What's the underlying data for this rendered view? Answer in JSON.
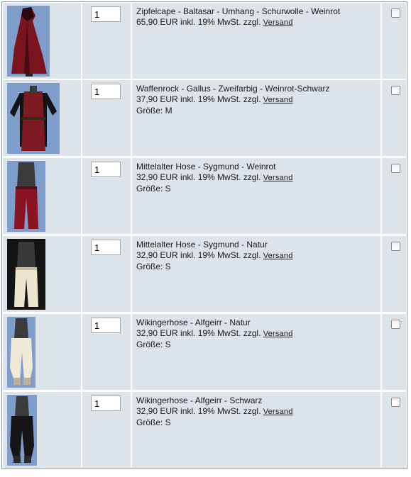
{
  "cart": {
    "items": [
      {
        "title": "Zipfelcape - Baltasar - Umhang - Schurwolle - Weinrot",
        "price": "65,90 EUR inkl. 19% MwSt. zzgl.",
        "shipping_link": "Versand",
        "size": "",
        "quantity": "1",
        "image": "red-hooded-cape-photo"
      },
      {
        "title": "Waffenrock - Gallus - Zweifarbig - Weinrot-Schwarz",
        "price": "37,90 EUR inkl. 19% MwSt. zzgl.",
        "shipping_link": "Versand",
        "size": "Größe: M",
        "quantity": "1",
        "image": "red-black-tunic-photo"
      },
      {
        "title": "Mittelalter Hose - Sygmund - Weinrot",
        "price": "32,90 EUR inkl. 19% MwSt. zzgl.",
        "shipping_link": "Versand",
        "size": "Größe: S",
        "quantity": "1",
        "image": "red-trousers-photo"
      },
      {
        "title": "Mittelalter Hose - Sygmund - Natur",
        "price": "32,90 EUR inkl. 19% MwSt. zzgl.",
        "shipping_link": "Versand",
        "size": "Größe: S",
        "quantity": "1",
        "image": "natural-trousers-photo"
      },
      {
        "title": "Wikingerhose - Alfgeirr - Natur",
        "price": "32,90 EUR inkl. 19% MwSt. zzgl.",
        "shipping_link": "Versand",
        "size": "Größe: S",
        "quantity": "1",
        "image": "natural-viking-trousers-photo"
      },
      {
        "title": "Wikingerhose - Alfgeirr - Schwarz",
        "price": "32,90 EUR inkl. 19% MwSt. zzgl.",
        "shipping_link": "Versand",
        "size": "Größe: S",
        "quantity": "1",
        "image": "black-viking-trousers-photo"
      }
    ]
  },
  "colors": {
    "row_background": "#dce3e9",
    "border": "#8c949c",
    "photo_background": "#6f8fbf"
  }
}
